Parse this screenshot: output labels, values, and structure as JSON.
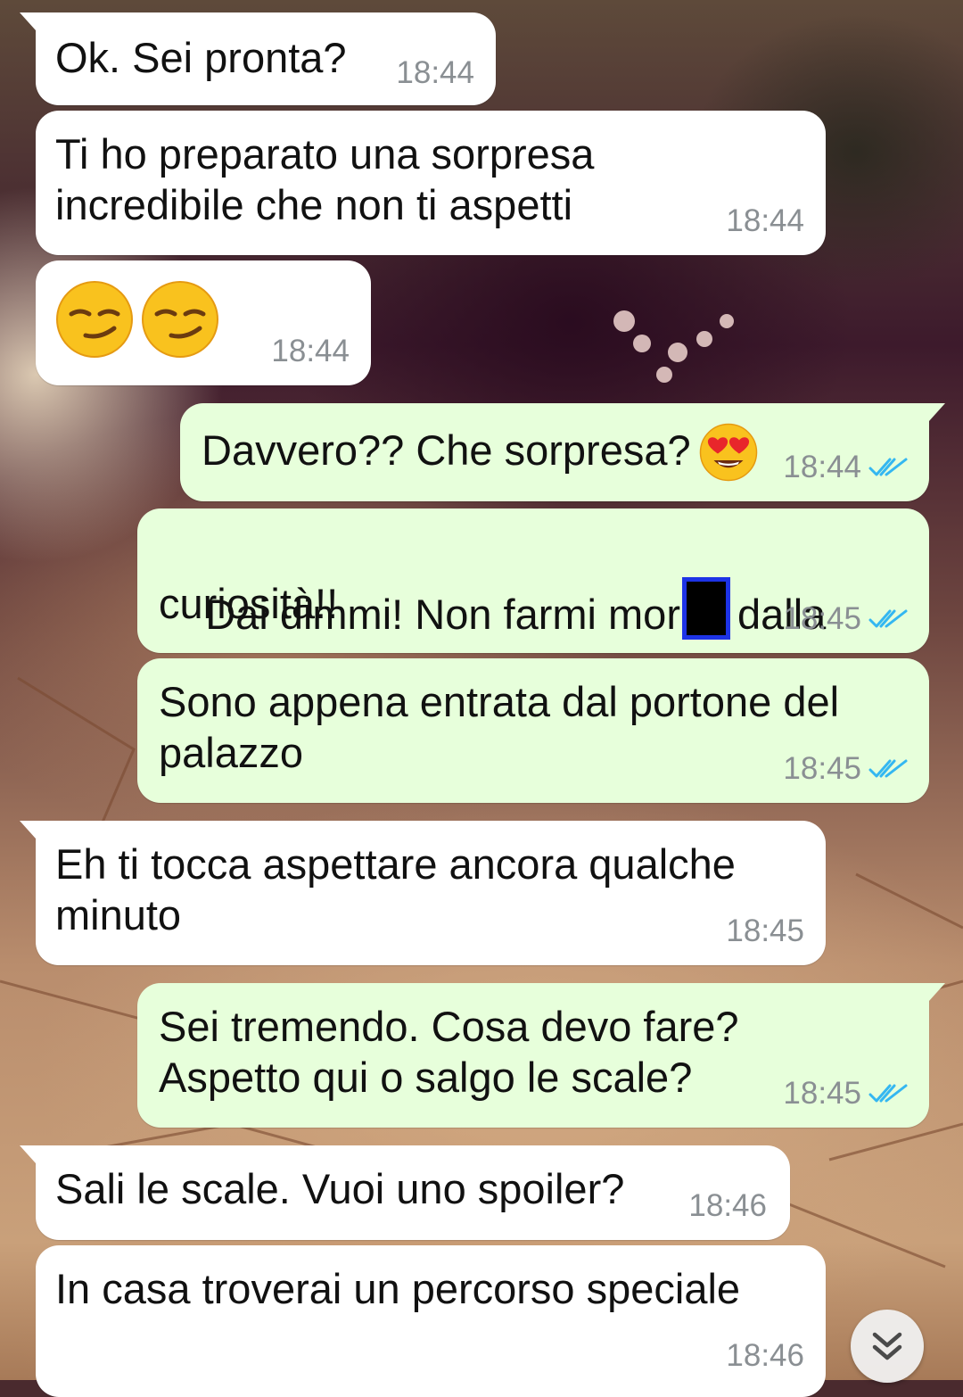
{
  "chat": {
    "messages": [
      {
        "direction": "incoming",
        "text": "Ok. Sei pronta?",
        "time": "18:44"
      },
      {
        "direction": "incoming",
        "text": "Ti ho preparato una sorpresa\nincredibile che non ti aspetti",
        "time": "18:44"
      },
      {
        "direction": "incoming",
        "emoji": [
          "smirking-face",
          "smirking-face"
        ],
        "time": "18:44"
      },
      {
        "direction": "outgoing",
        "text": "Davvero?? Che sorpresa?",
        "emoji": "heart-eyes-face",
        "time": "18:44",
        "status": "read"
      },
      {
        "direction": "outgoing",
        "text_before": "Dai dimmi! Non farmi mor",
        "redacted": true,
        "text_after": "dalla",
        "text_line2": "curiosità!!",
        "time": "18:45",
        "status": "read"
      },
      {
        "direction": "outgoing",
        "text": "Sono appena entrata dal portone del\npalazzo",
        "time": "18:45",
        "status": "read"
      },
      {
        "direction": "incoming",
        "text": "Eh ti tocca aspettare ancora qualche\nminuto",
        "time": "18:45"
      },
      {
        "direction": "outgoing",
        "text": "Sei tremendo. Cosa devo fare?\nAspetto qui o salgo le scale?",
        "time": "18:45",
        "status": "read"
      },
      {
        "direction": "incoming",
        "text": "Sali le scale. Vuoi uno spoiler?",
        "time": "18:46"
      },
      {
        "direction": "incoming",
        "text": "In casa troverai un percorso speciale",
        "time": "18:46"
      }
    ]
  },
  "controls": {
    "scroll_down_icon": "double-chevron-down-icon"
  },
  "colors": {
    "incoming_bubble": "#ffffff",
    "outgoing_bubble": "#e7ffdb",
    "read_ticks": "#34b7f1",
    "timestamp": "#8a8f93",
    "redaction_border": "#1d33e6"
  }
}
